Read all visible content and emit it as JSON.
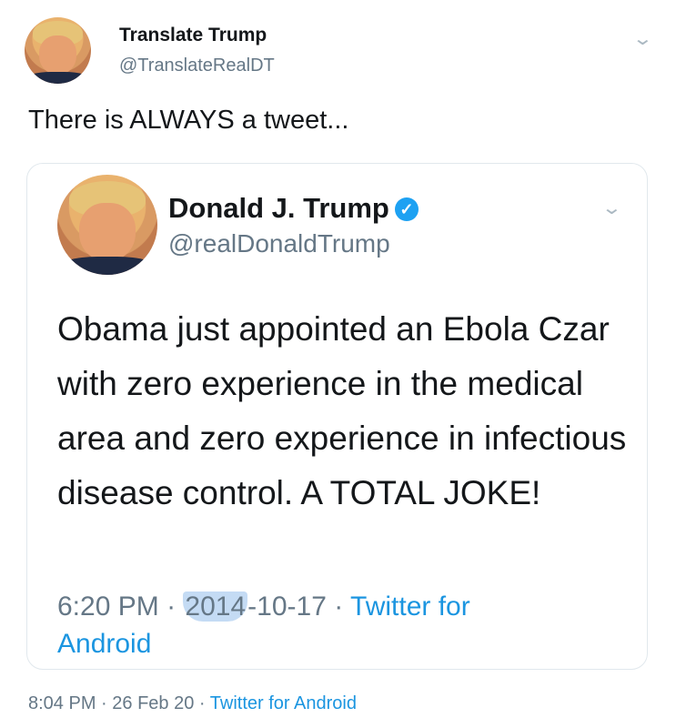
{
  "outer_tweet": {
    "name": "Translate Trump",
    "handle": "@TranslateRealDT",
    "text": "There is ALWAYS a tweet...",
    "time": "8:04 PM",
    "date": "26 Feb 20",
    "separator": "·",
    "source": "Twitter for Android",
    "menu_icon": "chevron-down-icon"
  },
  "quoted_tweet": {
    "name": "Donald J. Trump",
    "handle": "@realDonaldTrump",
    "verified_icon": "verified-badge-icon",
    "verified_glyph": "✓",
    "text": "Obama just appointed an Ebola Czar with zero experience in the medical area and zero experience in infectious disease control. A TOTAL JOKE!",
    "time": "6:20 PM",
    "date_year": "2014",
    "date_rest": "-10-17",
    "separator": "·",
    "source_line1": "Twitter for",
    "source_line2": "Android",
    "menu_icon": "chevron-down-icon"
  },
  "colors": {
    "link": "#1b95e0",
    "muted": "#657786",
    "verified": "#1da1f2",
    "highlight": "#7dafe6"
  }
}
